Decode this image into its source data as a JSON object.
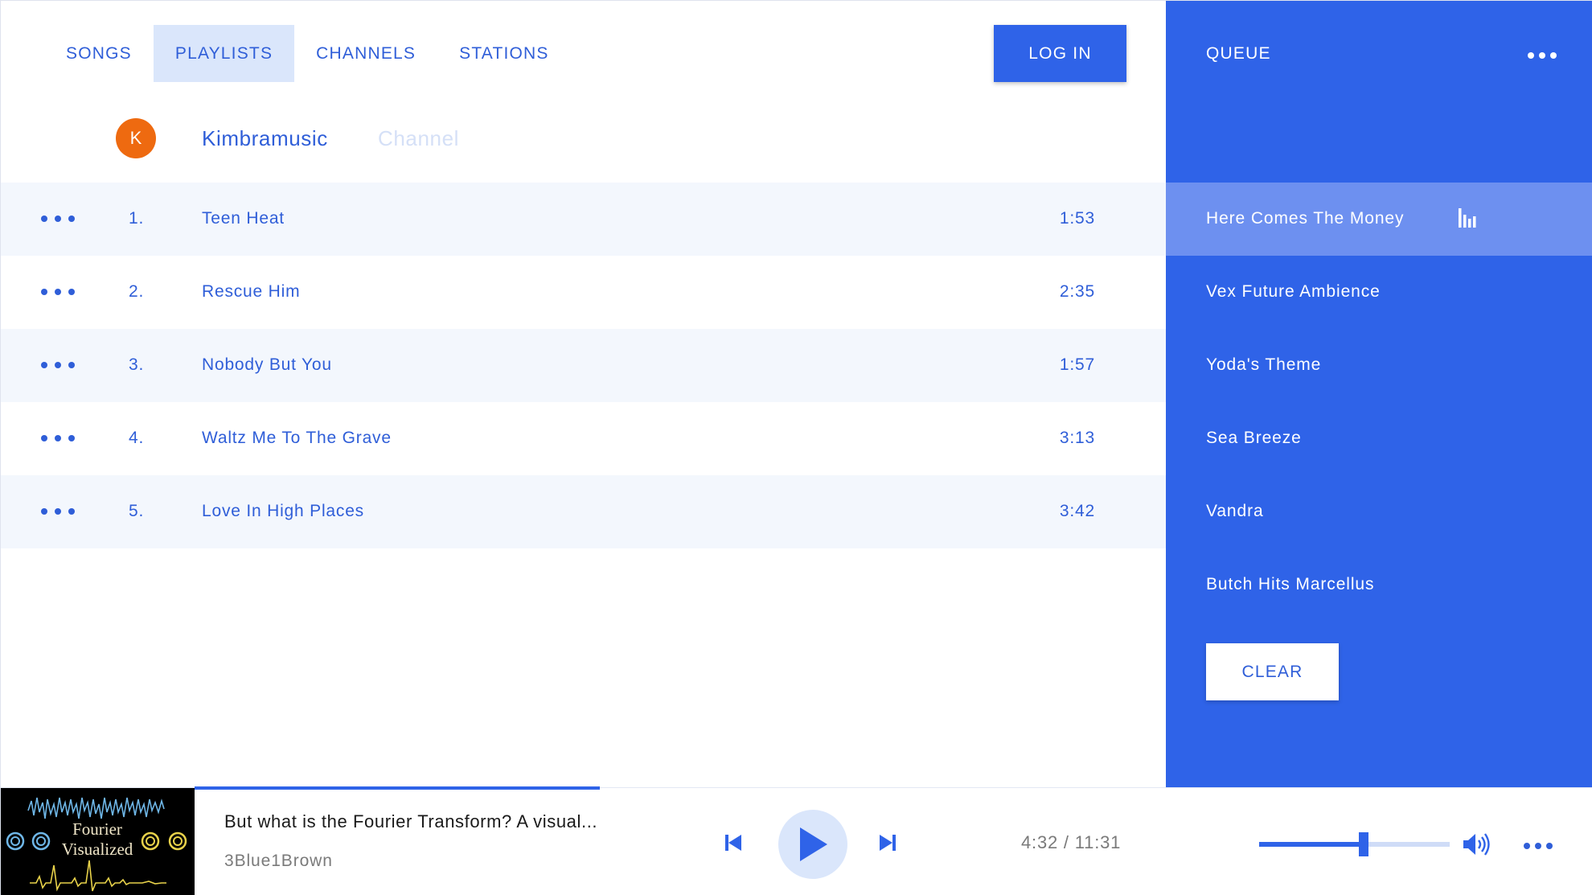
{
  "nav": {
    "tabs": [
      {
        "label": "SONGS",
        "active": false
      },
      {
        "label": "PLAYLISTS",
        "active": true
      },
      {
        "label": "CHANNELS",
        "active": false
      },
      {
        "label": "STATIONS",
        "active": false
      }
    ],
    "login_label": "LOG IN"
  },
  "channel": {
    "avatar_letter": "K",
    "name": "Kimbramusic",
    "type_label": "Channel"
  },
  "songs": [
    {
      "number": "1.",
      "title": "Teen Heat",
      "duration": "1:53"
    },
    {
      "number": "2.",
      "title": "Rescue Him",
      "duration": "2:35"
    },
    {
      "number": "3.",
      "title": "Nobody But You",
      "duration": "1:57"
    },
    {
      "number": "4.",
      "title": "Waltz Me To The Grave",
      "duration": "3:13"
    },
    {
      "number": "5.",
      "title": "Love In High Places",
      "duration": "3:42"
    }
  ],
  "queue": {
    "title": "QUEUE",
    "items": [
      {
        "label": "Here Comes The Money",
        "playing": true
      },
      {
        "label": "Vex Future Ambience",
        "playing": false
      },
      {
        "label": "Yoda's Theme",
        "playing": false
      },
      {
        "label": "Sea Breeze",
        "playing": false
      },
      {
        "label": "Vandra",
        "playing": false
      },
      {
        "label": "Butch Hits Marcellus",
        "playing": false
      }
    ],
    "clear_label": "CLEAR"
  },
  "player": {
    "thumbnail_text": [
      "Fourier",
      "Visualized"
    ],
    "title": "But what is the Fourier Transform? A visual...",
    "artist": "3Blue1Brown",
    "time_readout": "4:32 / 11:31",
    "progress_fraction": 0.29,
    "volume_fraction": 0.55
  },
  "icons": {
    "row_more": "more-horizontal-icon",
    "queue_more": "more-horizontal-icon",
    "now_playing": "equalizer-icon",
    "prev": "skip-previous-icon",
    "play": "play-icon",
    "next": "skip-next-icon",
    "volume": "volume-icon",
    "player_more": "more-horizontal-icon"
  },
  "colors": {
    "accent": "#2f63e8",
    "text_accent": "#2f5ed8",
    "tab_active_bg": "#dae6fb",
    "row_alt_bg": "#f3f7fd",
    "queue_bg": "#2f63e8",
    "queue_current_bg": "#6d90f0",
    "avatar_bg": "#ee6a10",
    "muted_text": "#7a7a7a"
  }
}
